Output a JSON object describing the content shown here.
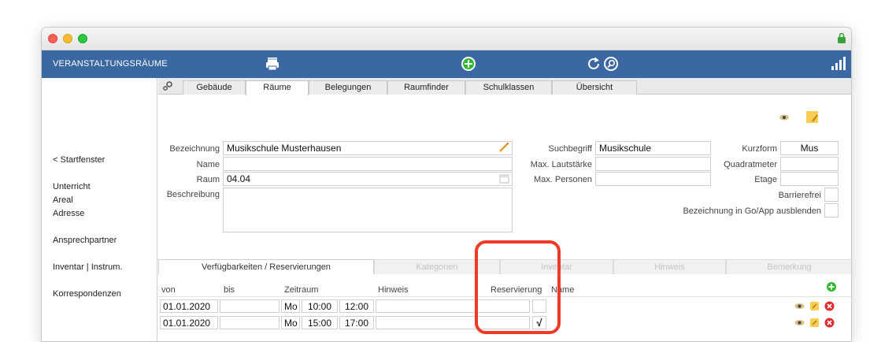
{
  "toolbar": {
    "title": "VERANSTALTUNGSRÄUME"
  },
  "sidebar": {
    "back": "< Startfenster",
    "items": [
      "Unterricht",
      "Areal",
      "Adresse",
      "Ansprechpartner",
      "Inventar | Instrum.",
      "Korrespondenzen"
    ]
  },
  "tabs": [
    "Gebäude",
    "Räume",
    "Belegungen",
    "Raumfinder",
    "Schulklassen",
    "Übersicht"
  ],
  "active_tab": "Räume",
  "form": {
    "bezeichnung_label": "Bezeichnung",
    "bezeichnung_value": "Musikschule Musterhausen",
    "name_label": "Name",
    "name_value": "",
    "raum_label": "Raum",
    "raum_value": "04.04",
    "beschreibung_label": "Beschreibung",
    "beschreibung_value": "",
    "suchbegriff_label": "Suchbegriff",
    "suchbegriff_value": "Musikschule",
    "max_lautstaerke_label": "Max. Lautstärke",
    "max_lautstaerke_value": "",
    "max_personen_label": "Max. Personen",
    "max_personen_value": "",
    "kurzform_label": "Kurzform",
    "kurzform_value": "Mus",
    "quadratmeter_label": "Quadratmeter",
    "quadratmeter_value": "",
    "etage_label": "Etage",
    "etage_value": "",
    "barrierefrei_label": "Barrierefrei",
    "ausblenden_label": "Bezeichnung in Go/App ausblenden"
  },
  "subtabs": [
    "Verfügbarkeiten / Reservierungen",
    "Kategorien",
    "Inventar",
    "Hinweis",
    "Bemerkung"
  ],
  "active_subtab": "Verfügbarkeiten / Reservierungen",
  "table": {
    "headers": {
      "von": "von",
      "bis": "bis",
      "zeitraum": "Zeitraum",
      "hinweis": "Hinweis",
      "reservierung": "Reservierung",
      "name": "Name"
    },
    "rows": [
      {
        "von": "01.01.2020",
        "bis": "",
        "tag": "Mo",
        "start": "10:00",
        "ende": "12:00",
        "hinweis": "",
        "reservierung": ""
      },
      {
        "von": "01.01.2020",
        "bis": "",
        "tag": "Mo",
        "start": "15:00",
        "ende": "17:00",
        "hinweis": "",
        "reservierung": "√"
      }
    ]
  },
  "colors": {
    "toolbar": "#3b67a3",
    "highlight": "#ef3b26",
    "add_green": "#2eb82e",
    "delete_red": "#e52b2b"
  }
}
